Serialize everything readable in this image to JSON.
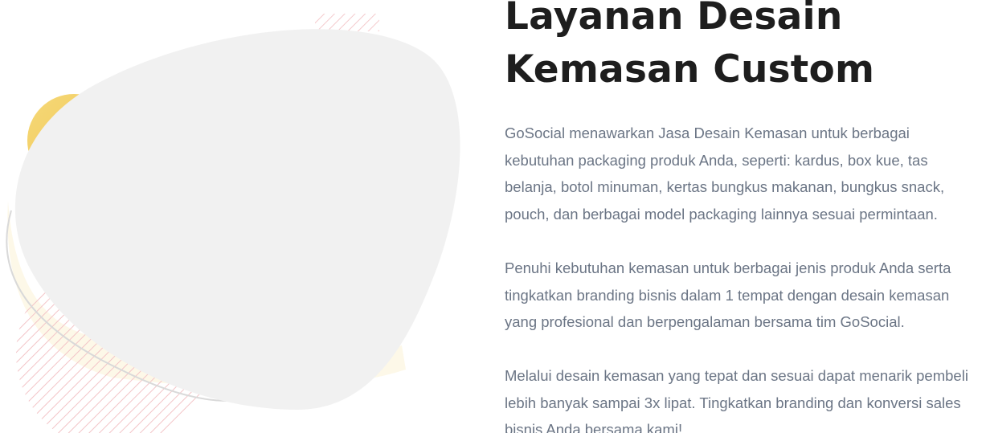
{
  "hero": {
    "title_lines": [
      "Layanan Desain",
      "Kemasan Custom"
    ],
    "paragraphs": [
      [
        "GoSocial menawarkan Jasa Desain Kemasan untuk berbagai",
        "kebutuhan packaging produk Anda, seperti: kardus, box kue, tas",
        "belanja, botol minuman, kertas bungkus makanan, bungkus snack,",
        "pouch, dan berbagai model packaging lainnya sesuai permintaan."
      ],
      [
        "Penuhi kebutuhan kemasan untuk berbagai jenis produk Anda serta",
        "tingkatkan branding bisnis dalam 1 tempat dengan desain kemasan",
        "yang profesional dan berpengalaman bersama tim GoSocial."
      ],
      [
        "Melalui desain kemasan yang tepat dan sesuai dapat menarik pembeli",
        "lebih banyak sampai 3x lipat. Tingkatkan branding dan konversi sales",
        "bisnis Anda bersama kami!"
      ]
    ]
  },
  "colors": {
    "blob": "#f1f1f1",
    "accent_yellow": "#f2cf63",
    "stripe_pink": "#f3c4c7",
    "title": "#1e1e1e",
    "body_text": "#6b7585"
  }
}
